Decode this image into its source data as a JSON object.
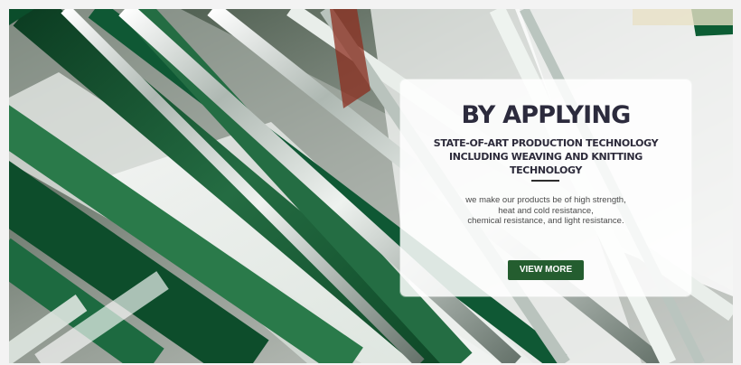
{
  "hero": {
    "headline": "BY APPLYING",
    "subheadline_line1": "STATE-OF-ART PRODUCTION TECHNOLOGY",
    "subheadline_line2": "INCLUDING WEAVING AND KNITTING TECHNOLOGY",
    "description_line1": "we make our products be of high strength,",
    "description_line2": "heat and cold resistance,",
    "description_line3": "chemical resistance, and light resistance.",
    "button_label": "VIEW MORE",
    "button_color": "#245d2f",
    "background_icon": "factory-rollers-image"
  }
}
